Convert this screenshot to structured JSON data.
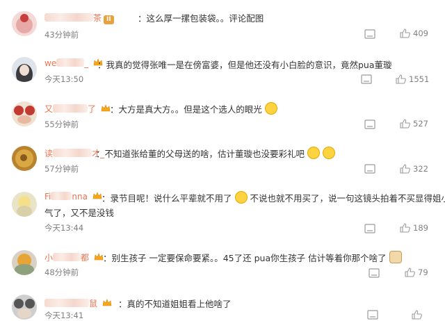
{
  "comments": [
    {
      "name_start": "",
      "name_end": "茶",
      "level": "II",
      "text": "：这么厚一摞包装袋。。",
      "link": "评论配图",
      "time": "43分钟前",
      "likes": "409"
    },
    {
      "name_start": "we",
      "name_end": "_",
      "text": "：我真的觉得张唯一是在傍富婆，但是他还没有小白脸的意识，竟然pua董璇",
      "time": "今天13:50",
      "likes": "1551"
    },
    {
      "name_start": "又",
      "name_end": "了",
      "text": "：大方是真大方。。但是这个选人的眼光",
      "time": "55分钟前",
      "likes": "527"
    },
    {
      "name_start": "读",
      "name_end": "才_",
      "text": "：不知道张给董的父母送的啥，估计董璇也没要彩礼吧",
      "time": "57分钟前",
      "likes": "322"
    },
    {
      "name_start": "Fi",
      "name_end": "nna",
      "text": "：录节目呢！说什么平辈就不用了",
      "text_b": "不说也就不用买了，说一句这镜头拍着不买显得姐小",
      "text2": "气了，又不是没钱",
      "time": "今天13:44",
      "likes": "189"
    },
    {
      "name_start": "小",
      "name_end": "都",
      "text": "：别生孩子 一定要保命要紧。。45了还 pua你生孩子 估计等着你那个啥了",
      "time": "48分钟前",
      "likes": "79"
    },
    {
      "name_start": "",
      "name_end": "鼠",
      "text": "：真的不知道姐姐看上他啥了",
      "time": "今天13:41",
      "likes": ""
    }
  ],
  "icons": {
    "share": "share-icon",
    "like": "thumbs-up-icon",
    "crown": "vip-crown-icon",
    "level": "level-badge-icon"
  },
  "colors": {
    "name": "#eb7350",
    "time": "#808080",
    "text": "#333333"
  }
}
